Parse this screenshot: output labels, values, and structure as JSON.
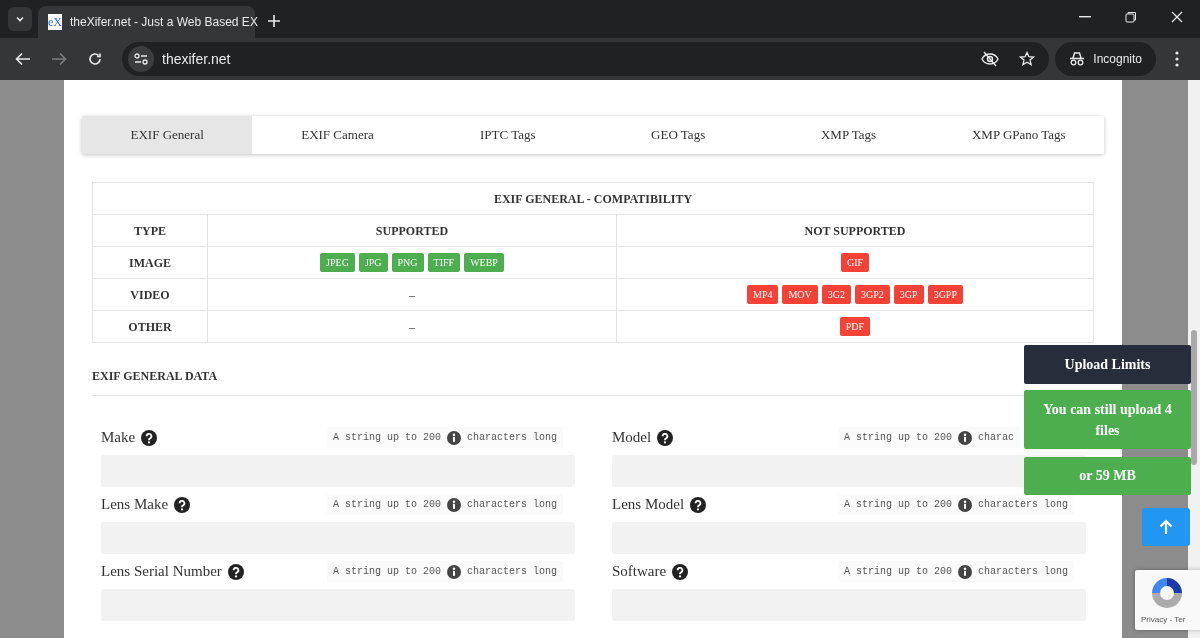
{
  "browser": {
    "tab_title": "theXifer.net - Just a Web Based EX",
    "favicon_text": "eX",
    "url": "thexifer.net",
    "profile_label": "Incognito"
  },
  "tabs": [
    {
      "label": "EXIF General",
      "selected": true
    },
    {
      "label": "EXIF Camera",
      "selected": false
    },
    {
      "label": "IPTC Tags",
      "selected": false
    },
    {
      "label": "GEO Tags",
      "selected": false
    },
    {
      "label": "XMP Tags",
      "selected": false
    },
    {
      "label": "XMP GPano Tags",
      "selected": false
    }
  ],
  "compat": {
    "title": "EXIF GENERAL - COMPATIBILITY",
    "columns": [
      "TYPE",
      "SUPPORTED",
      "NOT SUPPORTED"
    ],
    "rows": [
      {
        "type": "IMAGE",
        "supported": {
          "badges": [
            "JPEG",
            "JPG",
            "PNG",
            "TIFF",
            "WEBP"
          ]
        },
        "not_supported": {
          "badges": [
            "GIF"
          ]
        }
      },
      {
        "type": "VIDEO",
        "supported": {
          "text": "–"
        },
        "not_supported": {
          "badges": [
            "MP4",
            "MOV",
            "3G2",
            "3GP2",
            "3GP",
            "3GPP"
          ]
        }
      },
      {
        "type": "OTHER",
        "supported": {
          "text": "–"
        },
        "not_supported": {
          "badges": [
            "PDF"
          ]
        }
      }
    ]
  },
  "section_title": "EXIF GENERAL DATA",
  "fields": [
    {
      "label": "Make",
      "hint_before": "A string up to 200",
      "hint_after": "characters long"
    },
    {
      "label": "Model",
      "hint_before": "A string up to 200",
      "hint_after": "charac"
    },
    {
      "label": "Lens Make",
      "hint_before": "A string up to 200",
      "hint_after": "characters long"
    },
    {
      "label": "Lens Model",
      "hint_before": "A string up to 200",
      "hint_after": "characters long"
    },
    {
      "label": "Lens Serial Number",
      "hint_before": "A string up to 200",
      "hint_after": "characters long"
    },
    {
      "label": "Software",
      "hint_before": "A string up to 200",
      "hint_after": "characters long"
    }
  ],
  "upload": {
    "title": "Upload Limits",
    "files_text": "You can still upload 4 files",
    "size_text": "or 59 MB"
  },
  "recaptcha": {
    "text": "Privacy - Ter"
  }
}
